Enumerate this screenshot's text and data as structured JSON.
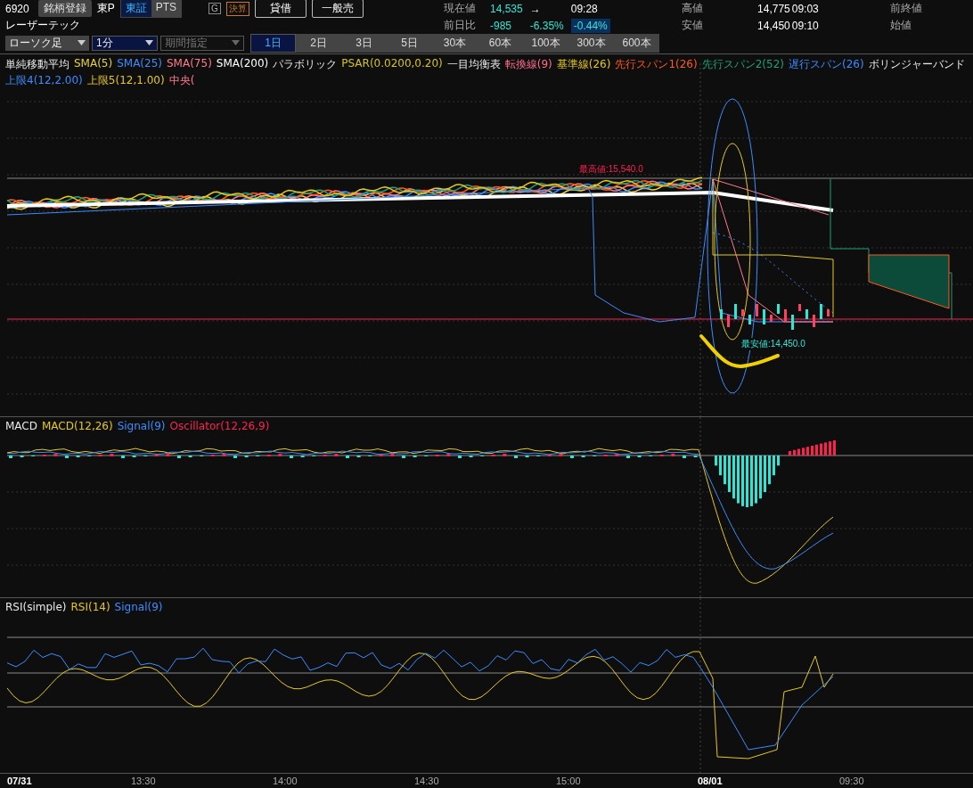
{
  "header": {
    "code": "6920",
    "register_button": "銘柄登録",
    "name": "レーザーテック",
    "market": "東P",
    "market_tabs": [
      {
        "label": "東証",
        "selected": true
      },
      {
        "label": "PTS",
        "selected": false
      }
    ],
    "badges": [
      {
        "label": "G",
        "kind": "plain"
      },
      {
        "label": "決算",
        "kind": "earnings"
      }
    ],
    "trade_buttons": [
      "貸借",
      "一般売"
    ]
  },
  "quote": {
    "current_label": "現在値",
    "current": "14,535",
    "trend": "→",
    "time": "09:28",
    "change_label": "前日比",
    "change": "-985",
    "change_pct": "-6.35%",
    "extra_pct": "-0.44%",
    "high_label": "高値",
    "high": "14,775",
    "high_time": "09:03",
    "low_label": "安値",
    "low": "14,450",
    "low_time": "09:10",
    "prev_close_label": "前終値",
    "open_label": "始値"
  },
  "toolbar": {
    "chart_type": "ローソク足",
    "interval": "1分",
    "period": {
      "placeholder": "期間指定",
      "disabled": true
    },
    "ranges": [
      {
        "label": "1日",
        "selected": true
      },
      {
        "label": "2日",
        "selected": false
      },
      {
        "label": "3日",
        "selected": false
      },
      {
        "label": "5日",
        "selected": false
      },
      {
        "label": "30本",
        "selected": false
      },
      {
        "label": "60本",
        "selected": false
      },
      {
        "label": "100本",
        "selected": false
      },
      {
        "label": "300本",
        "selected": false
      },
      {
        "label": "600本",
        "selected": false
      }
    ]
  },
  "price_legend": [
    {
      "label": "単純移動平均",
      "kind": "heading"
    },
    {
      "label": "SMA(5)",
      "color": "#e6d23c"
    },
    {
      "label": "SMA(25)",
      "color": "#3c8cff"
    },
    {
      "label": "SMA(75)",
      "color": "#ff7a8a"
    },
    {
      "label": "SMA(200)",
      "color": "#ffffff"
    },
    {
      "label": "パラボリック",
      "kind": "heading"
    },
    {
      "label": "PSAR(0.0200,0.20)",
      "color": "#d4c21e"
    },
    {
      "label": "一目均衡表",
      "kind": "heading"
    },
    {
      "label": "転換線(9)",
      "color": "#ff6e8c"
    },
    {
      "label": "基準線(26)",
      "color": "#e6c81e"
    },
    {
      "label": "先行スパン1(26)",
      "color": "#ff5a1e"
    },
    {
      "label": "先行スパン2(52)",
      "color": "#1ea078"
    },
    {
      "label": "遅行スパン(26)",
      "color": "#3c8cff"
    },
    {
      "label": "ボリンジャーバンド",
      "kind": "heading"
    },
    {
      "label": "上限4(12,2.00)",
      "color": "#3c8cff"
    },
    {
      "label": "上限5(12,1.00)",
      "color": "#e6c81e"
    },
    {
      "label": "中央(",
      "color": "#ff7a8a"
    }
  ],
  "price_annotations": {
    "high": "最高値:15,540.0",
    "low": "最安値:14,450.0"
  },
  "macd_legend": [
    {
      "label": "MACD",
      "kind": "heading"
    },
    {
      "label": "MACD(12,26)",
      "color": "#e6c81e"
    },
    {
      "label": "Signal(9)",
      "color": "#3c8cff"
    },
    {
      "label": "Oscillator(12,26,9)",
      "color": "#ff2050"
    }
  ],
  "rsi_legend": [
    {
      "label": "RSI(simple)",
      "kind": "heading"
    },
    {
      "label": "RSI(14)",
      "color": "#e6c81e"
    },
    {
      "label": "Signal(9)",
      "color": "#3c8cff"
    }
  ],
  "x_axis": [
    {
      "label": "07/31",
      "kind": "date"
    },
    {
      "label": "13:30",
      "kind": "time"
    },
    {
      "label": "14:00",
      "kind": "time"
    },
    {
      "label": "14:30",
      "kind": "time"
    },
    {
      "label": "15:00",
      "kind": "time"
    },
    {
      "label": "08/01",
      "kind": "date"
    },
    {
      "label": "09:30",
      "kind": "time"
    }
  ]
}
